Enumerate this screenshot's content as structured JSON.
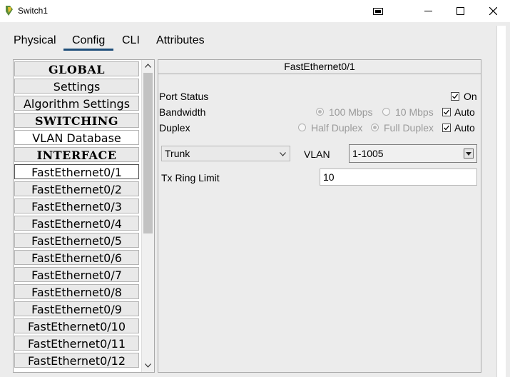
{
  "window": {
    "title": "Switch1"
  },
  "tabs": [
    "Physical",
    "Config",
    "CLI",
    "Attributes"
  ],
  "sidebar": {
    "items": [
      {
        "label": "GLOBAL"
      },
      {
        "label": "Settings"
      },
      {
        "label": "Algorithm Settings"
      },
      {
        "label": "SWITCHING"
      },
      {
        "label": "VLAN Database"
      },
      {
        "label": "INTERFACE"
      },
      {
        "label": "FastEthernet0/1"
      },
      {
        "label": "FastEthernet0/2"
      },
      {
        "label": "FastEthernet0/3"
      },
      {
        "label": "FastEthernet0/4"
      },
      {
        "label": "FastEthernet0/5"
      },
      {
        "label": "FastEthernet0/6"
      },
      {
        "label": "FastEthernet0/7"
      },
      {
        "label": "FastEthernet0/8"
      },
      {
        "label": "FastEthernet0/9"
      },
      {
        "label": "FastEthernet0/10"
      },
      {
        "label": "FastEthernet0/11"
      },
      {
        "label": "FastEthernet0/12"
      }
    ]
  },
  "main": {
    "header": "FastEthernet0/1",
    "port_status_label": "Port Status",
    "port_status_on": "On",
    "bandwidth_label": "Bandwidth",
    "bw_100": "100 Mbps",
    "bw_10": "10 Mbps",
    "bw_auto": "Auto",
    "duplex_label": "Duplex",
    "half_duplex": "Half Duplex",
    "full_duplex": "Full Duplex",
    "duplex_auto": "Auto",
    "mode_value": "Trunk",
    "vlan_label": "VLAN",
    "vlan_value": "1-1005",
    "tx_label": "Tx Ring Limit",
    "tx_value": "10"
  }
}
